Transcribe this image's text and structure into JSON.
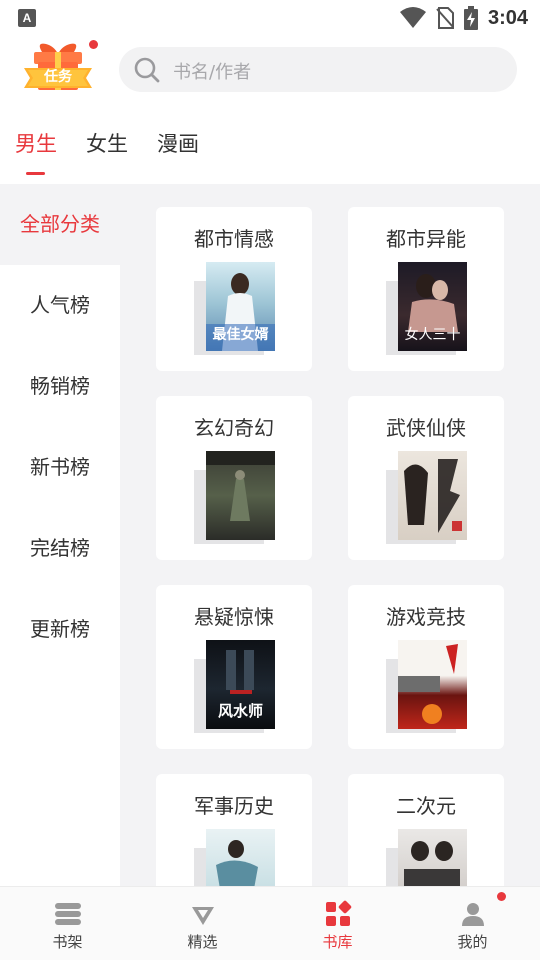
{
  "status_bar": {
    "time": "3:04",
    "notification_label": "A"
  },
  "header": {
    "task_label": "任务",
    "search_placeholder": "书名/作者"
  },
  "tabs": [
    {
      "label": "男生",
      "active": true
    },
    {
      "label": "女生",
      "active": false
    },
    {
      "label": "漫画",
      "active": false
    }
  ],
  "sidebar": {
    "items": [
      {
        "label": "全部分类",
        "active": true
      },
      {
        "label": "人气榜",
        "active": false
      },
      {
        "label": "畅销榜",
        "active": false
      },
      {
        "label": "新书榜",
        "active": false
      },
      {
        "label": "完结榜",
        "active": false
      },
      {
        "label": "更新榜",
        "active": false
      }
    ]
  },
  "categories": [
    {
      "title": "都市情感",
      "cover_text": "最佳女婿"
    },
    {
      "title": "都市异能",
      "cover_text": "女人三十"
    },
    {
      "title": "玄幻奇幻",
      "cover_text": ""
    },
    {
      "title": "武侠仙侠",
      "cover_text": ""
    },
    {
      "title": "悬疑惊悚",
      "cover_text": "风水师"
    },
    {
      "title": "游戏竞技",
      "cover_text": ""
    },
    {
      "title": "军事历史",
      "cover_text": ""
    },
    {
      "title": "二次元",
      "cover_text": ""
    }
  ],
  "bottom_nav": [
    {
      "label": "书架",
      "icon": "bookshelf-icon",
      "active": false
    },
    {
      "label": "精选",
      "icon": "diamond-icon",
      "active": false
    },
    {
      "label": "书库",
      "icon": "library-grid-icon",
      "active": true
    },
    {
      "label": "我的",
      "icon": "profile-icon",
      "active": false
    }
  ],
  "colors": {
    "accent": "#e8383d",
    "background": "#f3f3f5"
  }
}
